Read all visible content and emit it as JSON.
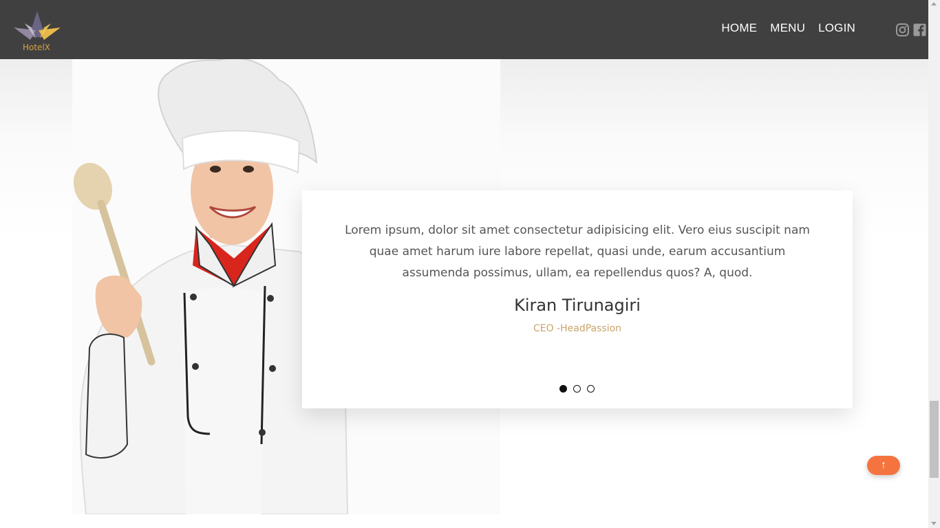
{
  "brand": {
    "name": "HotelX"
  },
  "nav": {
    "home": "HOME",
    "menu": "MENU",
    "login": "LOGIN"
  },
  "social": {
    "icons": [
      "instagram-icon",
      "facebook-icon"
    ]
  },
  "testimonial": {
    "quote": "Lorem ipsum, dolor sit amet consectetur adipisicing elit. Vero eius suscipit nam quae amet harum iure labore repellat, quasi unde, earum accusantium assumenda possimus, ullam, ea repellendus quos? A, quod.",
    "author": "Kiran Tirunagiri",
    "role": "CEO -HeadPassion",
    "slides": 3,
    "active_slide": 1
  },
  "scroll_top": {
    "icon": "↑"
  },
  "colors": {
    "navbar": "#404040",
    "accent": "#f5733f",
    "role_text": "#c9a46a",
    "logo_text": "#d9a441"
  }
}
